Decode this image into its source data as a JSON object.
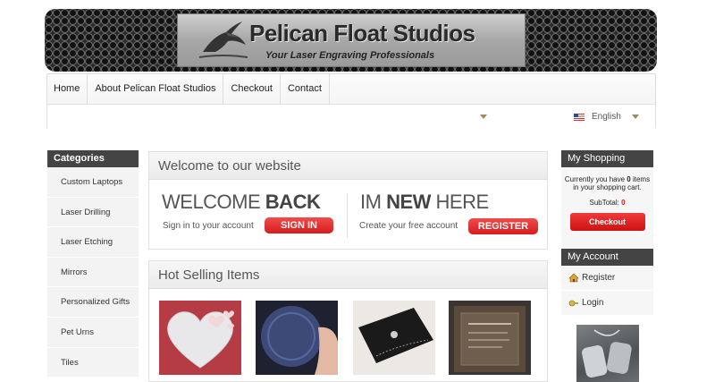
{
  "header": {
    "logo_title": "Pelican Float Studios",
    "logo_tagline": "Your Laser Engraving Professionals"
  },
  "nav": {
    "items": [
      "Home",
      "About Pelican Float Studios",
      "Checkout",
      "Contact"
    ],
    "language": "English"
  },
  "categories": {
    "title": "Categories",
    "items": [
      "Custom Laptops",
      "Laser Drilling",
      "Laser Etching",
      "Mirrors",
      "Personalized Gifts",
      "Pet Urns",
      "Tiles"
    ]
  },
  "welcome": {
    "heading": "Welcome to our website",
    "left_big_light": "WELCOME ",
    "left_big_bold": "BACK",
    "left_small": "Sign in to your account",
    "sign_in_label": "SIGN IN",
    "right_big_light": "IM ",
    "right_big_bold": "NEW",
    "right_big_tail": " HERE",
    "right_small": "Create your free account",
    "register_label": "REGISTER"
  },
  "hot": {
    "heading": "Hot Selling Items"
  },
  "basket": {
    "title": "My Shopping Basket",
    "line1_pre": "Currently you have ",
    "count": "0",
    "line1_post": " items",
    "line2": "in your shopping cart.",
    "subtotal_label": "SubTotal: ",
    "subtotal_value": "0",
    "checkout_label": "Checkout"
  },
  "account": {
    "title": "My Account",
    "register": "Register",
    "login": "Login"
  },
  "colors": {
    "accent_red": "#d51d1d",
    "link_blue": "#2a62a6",
    "dark_header": "#444444"
  }
}
